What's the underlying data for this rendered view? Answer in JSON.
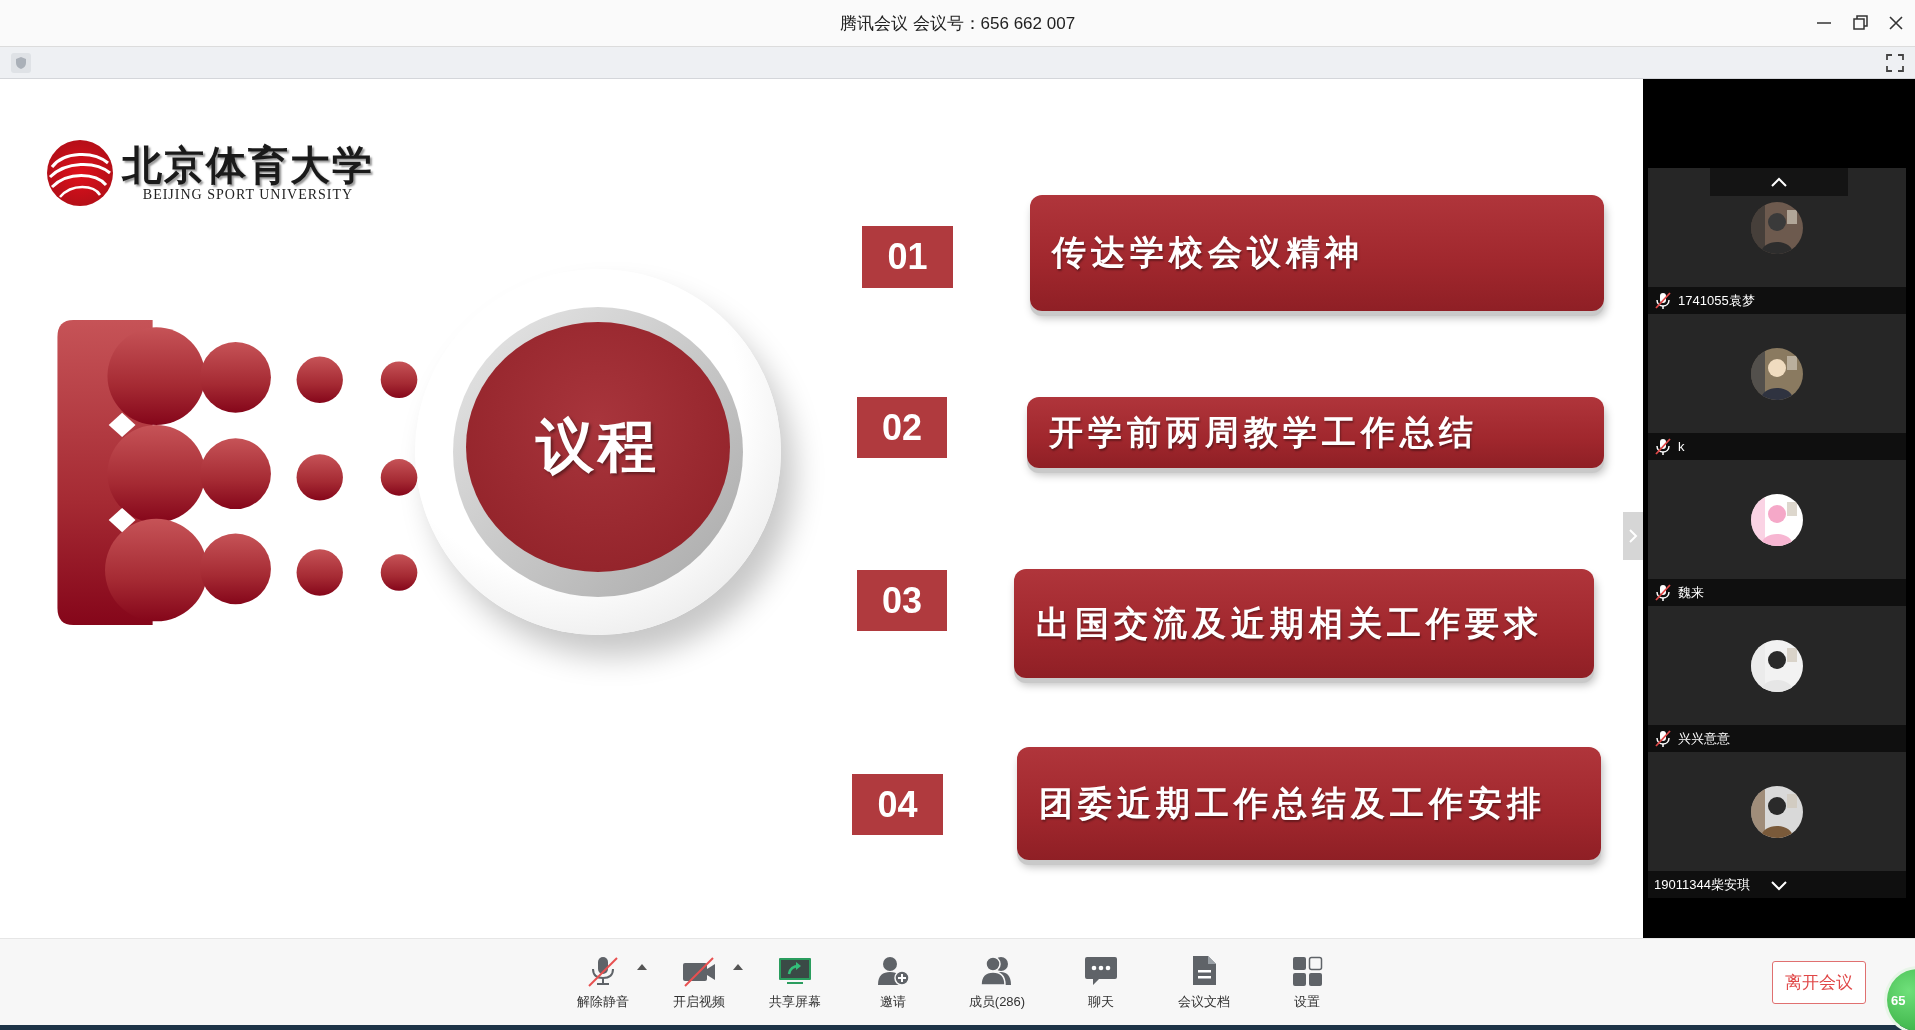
{
  "window": {
    "title": "腾讯会议 会议号：656 662 007"
  },
  "slide": {
    "logo": {
      "name": "北京体育大学",
      "subtitle": "BEIJING SPORT UNIVERSITY"
    },
    "heading": "议程",
    "agenda": [
      {
        "number": "01",
        "text": "传达学校会议精神"
      },
      {
        "number": "02",
        "text": "开学前两周教学工作总结"
      },
      {
        "number": "03",
        "text": "出国交流及近期相关工作要求"
      },
      {
        "number": "04",
        "text": "团委近期工作总结及工作安排"
      }
    ]
  },
  "participants": [
    {
      "name": "1741055袁梦",
      "muted": true
    },
    {
      "name": "k",
      "muted": true
    },
    {
      "name": "魏来",
      "muted": true
    },
    {
      "name": "兴兴意意",
      "muted": true
    },
    {
      "name": "19011344柴安琪",
      "muted": false
    }
  ],
  "toolbar": [
    {
      "kind": "mic",
      "label": "解除静音",
      "off": true,
      "menu": true
    },
    {
      "kind": "video",
      "label": "开启视频",
      "off": true,
      "menu": true
    },
    {
      "kind": "share",
      "label": "共享屏幕",
      "off": false,
      "menu": false
    },
    {
      "kind": "invite",
      "label": "邀请",
      "off": false,
      "menu": false
    },
    {
      "kind": "members",
      "label": "成员(286)",
      "off": false,
      "menu": false
    },
    {
      "kind": "chat",
      "label": "聊天",
      "off": false,
      "menu": false
    },
    {
      "kind": "docs",
      "label": "会议文档",
      "off": false,
      "menu": false
    },
    {
      "kind": "settings",
      "label": "设置",
      "off": false,
      "menu": false
    }
  ],
  "leave_button": "离开会议",
  "badge": "65"
}
